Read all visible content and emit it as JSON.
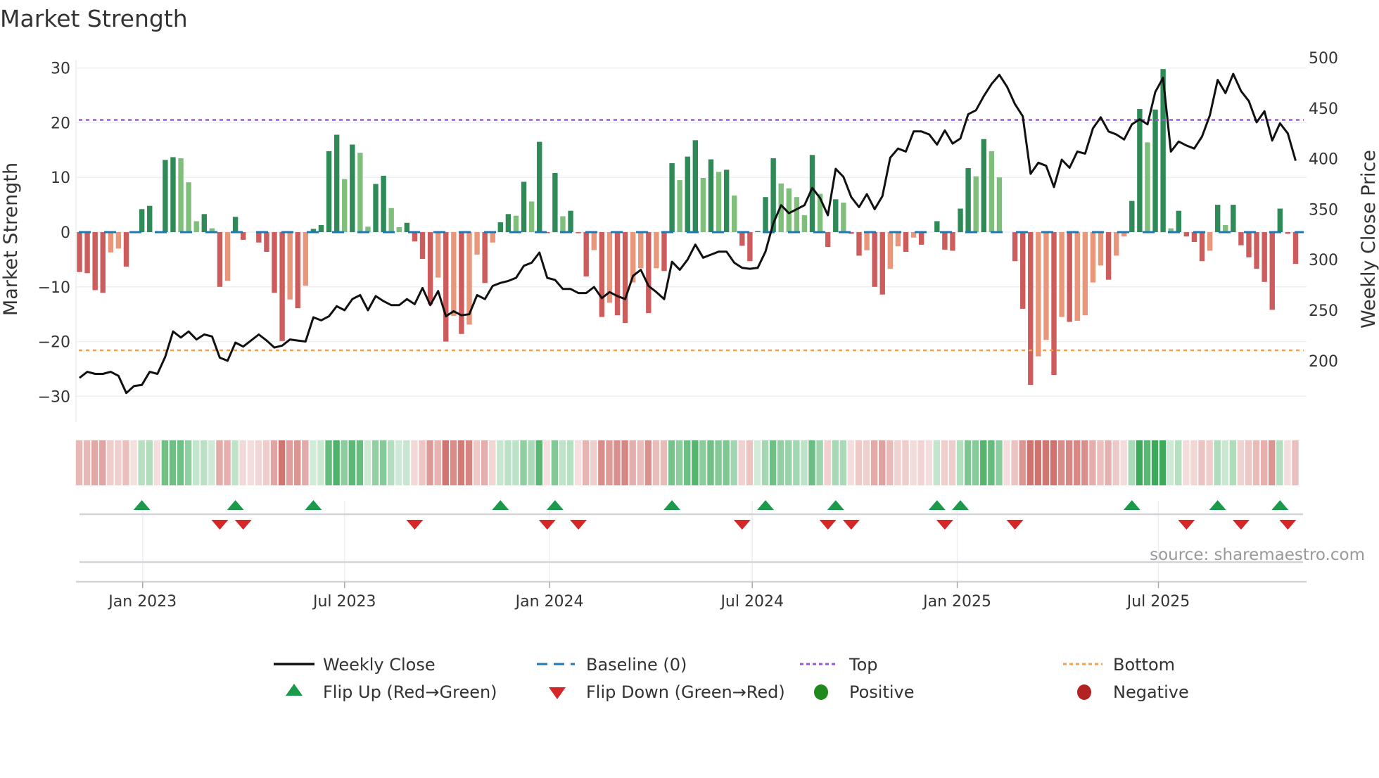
{
  "title": "Market Strength",
  "source": "source: sharemaestro.com",
  "legend": {
    "weekly_close": "Weekly Close",
    "baseline": "Baseline (0)",
    "top": "Top",
    "bottom": "Bottom",
    "flip_up": "Flip Up (Red→Green)",
    "flip_down": "Flip Down (Green→Red)",
    "positive": "Positive",
    "negative": "Negative"
  },
  "colors": {
    "strong_pos": "#2e8b57",
    "weak_pos": "#7fbf7b",
    "strong_neg": "#cd5c5c",
    "weak_neg": "#e9967a",
    "baseline": "#1f77b4",
    "top": "#9b59d6",
    "bottom": "#f0a050",
    "close": "#111111",
    "flip_up": "#1a9a4a",
    "flip_down": "#d62728",
    "positive": "#1e8a1e",
    "negative": "#b22222"
  },
  "chart_data": {
    "type": "bar",
    "title": "Market Strength",
    "ylabel": "Market Strength",
    "y2label": "Weekly Close Price",
    "ylim": [
      -33,
      33
    ],
    "y2lim": [
      160,
      510
    ],
    "yticks": [
      {
        "v": 30,
        "label": "30"
      },
      {
        "v": 20,
        "label": "20"
      },
      {
        "v": 10,
        "label": "10"
      },
      {
        "v": 0,
        "label": "0"
      },
      {
        "v": -10,
        "label": "−10"
      },
      {
        "v": -20,
        "label": "−20"
      },
      {
        "v": -30,
        "label": "−30"
      }
    ],
    "y2ticks": [
      {
        "v": 500,
        "label": "500"
      },
      {
        "v": 450,
        "label": "450"
      },
      {
        "v": 400,
        "label": "400"
      },
      {
        "v": 350,
        "label": "350"
      },
      {
        "v": 300,
        "label": "300"
      },
      {
        "v": 250,
        "label": "250"
      },
      {
        "v": 200,
        "label": "200"
      }
    ],
    "xticks": [
      {
        "week": 8.1,
        "label": "Jan 2023"
      },
      {
        "week": 34.0,
        "label": "Jul 2023"
      },
      {
        "week": 60.3,
        "label": "Jan 2024"
      },
      {
        "week": 86.3,
        "label": "Jul 2024"
      },
      {
        "week": 112.6,
        "label": "Jan 2025"
      },
      {
        "week": 138.4,
        "label": "Jul 2025"
      }
    ],
    "top_level": 20.5,
    "bottom_level": -21.6,
    "baseline": 0,
    "strength": [
      -7.3,
      -7.5,
      -10.6,
      -11.1,
      -3.7,
      -3.0,
      -6.3,
      -0.2,
      4.2,
      4.8,
      0,
      13.2,
      13.7,
      13.5,
      9.1,
      2.0,
      3.3,
      0.7,
      -10.0,
      -8.9,
      2.8,
      -1.4,
      0,
      -1.9,
      -3.6,
      -11.1,
      -19.9,
      -12.3,
      -13.9,
      -9.8,
      0.6,
      1.3,
      14.8,
      17.8,
      9.7,
      16.0,
      14.5,
      1.0,
      8.8,
      10.3,
      4.4,
      0.9,
      1.7,
      -1.7,
      -4.9,
      -13.2,
      -8.3,
      -20.0,
      -15.3,
      -18.6,
      -16.9,
      -4.1,
      -9.3,
      -1.9,
      1.8,
      3.3,
      3.0,
      9.2,
      5.6,
      16.5,
      -0.1,
      10.8,
      2.9,
      3.9,
      -0.2,
      -8.1,
      -3.3,
      -15.5,
      -12.9,
      -15.2,
      -16.6,
      -9.2,
      -6.6,
      -14.8,
      -6.6,
      -7.1,
      12.6,
      9.5,
      13.8,
      16.8,
      9.9,
      13.3,
      11.0,
      11.4,
      6.7,
      -2.5,
      -5.3,
      0.2,
      6.4,
      13.5,
      8.9,
      8.0,
      6.4,
      3.1,
      14.1,
      7.0,
      -2.7,
      6.0,
      5.4,
      -0.3,
      -4.3,
      -3.3,
      -10.0,
      -11.4,
      -6.7,
      -2.6,
      -3.6,
      -1.0,
      -2.3,
      0,
      2.0,
      -3.2,
      -3.4,
      4.3,
      11.7,
      10.2,
      17.0,
      14.8,
      10.0,
      0,
      -5.3,
      -14.0,
      -27.9,
      -22.7,
      -19.7,
      -26.1,
      -15.5,
      -16.4,
      -16.2,
      -15.2,
      -9.2,
      -6.1,
      -8.7,
      -4.3,
      -0.8,
      5.7,
      22.5,
      16.4,
      22.4,
      29.8,
      0.7,
      3.9,
      -0.8,
      -1.8,
      -5.3,
      -3.4,
      5.0,
      1.3,
      5.0,
      -2.4,
      -4.6,
      -6.7,
      -9.1,
      -14.2,
      4.3,
      -0.3,
      -5.8
    ],
    "weekly_close": [
      183,
      189,
      187,
      187,
      189,
      185,
      168,
      175,
      176,
      189,
      187,
      204,
      229,
      223,
      229,
      221,
      226,
      224,
      203,
      200,
      218,
      214,
      220,
      226,
      220,
      213,
      215,
      221,
      220,
      219,
      243,
      240,
      244,
      254,
      250,
      261,
      265,
      250,
      264,
      259,
      255,
      255,
      261,
      256,
      272,
      255,
      269,
      244,
      249,
      245,
      246,
      265,
      261,
      274,
      277,
      279,
      282,
      294,
      297,
      307,
      282,
      280,
      271,
      271,
      267,
      267,
      273,
      262,
      268,
      264,
      261,
      284,
      290,
      274,
      268,
      261,
      298,
      290,
      300,
      315,
      302,
      305,
      308,
      308,
      297,
      292,
      291,
      292,
      308,
      336,
      354,
      346,
      350,
      354,
      371,
      361,
      344,
      390,
      382,
      362,
      352,
      365,
      350,
      363,
      401,
      410,
      407,
      427,
      427,
      424,
      414,
      428,
      415,
      420,
      444,
      448,
      462,
      474,
      483,
      471,
      454,
      442,
      385,
      396,
      393,
      372,
      399,
      391,
      407,
      405,
      430,
      441,
      427,
      424,
      419,
      434,
      439,
      434,
      466,
      480,
      407,
      417,
      413,
      410,
      422,
      443,
      478,
      465,
      484,
      467,
      457,
      436,
      447,
      418,
      435,
      425,
      398
    ],
    "flip_up_weeks": [
      9,
      21,
      31,
      55,
      62,
      77,
      89,
      98,
      111,
      114,
      136,
      147,
      155
    ],
    "flip_down_weeks": [
      19,
      22,
      44,
      61,
      65,
      86,
      97,
      100,
      112,
      121,
      143,
      150,
      156
    ]
  }
}
